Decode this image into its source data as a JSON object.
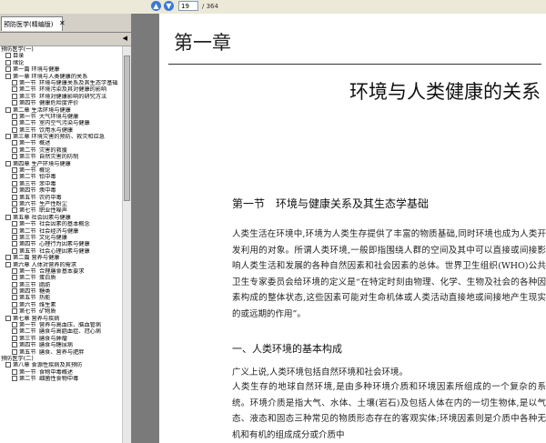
{
  "toolbar": {
    "page_current": "19",
    "page_total": "/ 364"
  },
  "sidebar": {
    "tab_label": "预防医学(精编版)",
    "tree": [
      {
        "level": 0,
        "label": "预防医学(一)"
      },
      {
        "level": 1,
        "label": "目录"
      },
      {
        "level": 1,
        "label": "绪论"
      },
      {
        "level": 1,
        "label": "第一篇 环境与健康"
      },
      {
        "level": 1,
        "label": "第一章 环境与人类健康的关系"
      },
      {
        "level": 2,
        "sec": "第一节",
        "label": "环境与健康关系及其生态学基础"
      },
      {
        "level": 2,
        "sec": "第二节",
        "label": "环境污染及其对健康的影响"
      },
      {
        "level": 2,
        "sec": "第三节",
        "label": "环境对健康影响的研究方法"
      },
      {
        "level": 2,
        "sec": "第四节",
        "label": "健康危险度评价"
      },
      {
        "level": 1,
        "label": "第二章 生活环境与健康"
      },
      {
        "level": 2,
        "sec": "第一节",
        "label": "大气环境与健康"
      },
      {
        "level": 2,
        "sec": "第二节",
        "label": "室内空气污染与健康"
      },
      {
        "level": 2,
        "sec": "第三节",
        "label": "饮用水与健康"
      },
      {
        "level": 1,
        "label": "第三章 环境灾害的预防、救灾和应急"
      },
      {
        "level": 2,
        "sec": "第一节",
        "label": "概述"
      },
      {
        "level": 2,
        "sec": "第二节",
        "label": "灾害的救援"
      },
      {
        "level": 2,
        "sec": "第三节",
        "label": "自然灾害的防制"
      },
      {
        "level": 1,
        "label": "第四章 生产环境与健康"
      },
      {
        "level": 2,
        "sec": "第一节",
        "label": "概论"
      },
      {
        "level": 2,
        "sec": "第二节",
        "label": "铅中毒"
      },
      {
        "level": 2,
        "sec": "第三节",
        "label": "苯中毒"
      },
      {
        "level": 2,
        "sec": "第四节",
        "label": "汞中毒"
      },
      {
        "level": 2,
        "sec": "第五节",
        "label": "农药中毒"
      },
      {
        "level": 2,
        "sec": "第六节",
        "label": "生产性粉尘"
      },
      {
        "level": 2,
        "sec": "第七节",
        "label": "职业性噪声"
      },
      {
        "level": 1,
        "label": "第五章 社会因素与健康"
      },
      {
        "level": 2,
        "sec": "第一节",
        "label": "社会因素的基本概念"
      },
      {
        "level": 2,
        "sec": "第二节",
        "label": "社会经济与健康"
      },
      {
        "level": 2,
        "sec": "第三节",
        "label": "文化与健康"
      },
      {
        "level": 2,
        "sec": "第四节",
        "label": "心理行为因素与健康"
      },
      {
        "level": 2,
        "sec": "第五节",
        "label": "社会心理因素与健康"
      },
      {
        "level": 1,
        "label": "第二篇 营养与健康"
      },
      {
        "level": 1,
        "label": "第六章 人体对营养的需求"
      },
      {
        "level": 2,
        "sec": "第一节",
        "label": "合理膳食基本要求"
      },
      {
        "level": 2,
        "sec": "第二节",
        "label": "蛋白质"
      },
      {
        "level": 2,
        "sec": "第三节",
        "label": "脂肪"
      },
      {
        "level": 2,
        "sec": "第四节",
        "label": "糖类"
      },
      {
        "level": 2,
        "sec": "第五节",
        "label": "热能"
      },
      {
        "level": 2,
        "sec": "第六节",
        "label": "维生素"
      },
      {
        "level": 2,
        "sec": "第七节",
        "label": "矿物质"
      },
      {
        "level": 1,
        "label": "第七章 营养与疾病"
      },
      {
        "level": 2,
        "sec": "第一节",
        "label": "营养与高血压、脑血管病"
      },
      {
        "level": 2,
        "sec": "第二节",
        "label": "膳食与高脂血症、冠心病"
      },
      {
        "level": 2,
        "sec": "第三节",
        "label": "膳食与肿瘤"
      },
      {
        "level": 2,
        "sec": "第四节",
        "label": "膳食与糖尿病"
      },
      {
        "level": 2,
        "sec": "第五节",
        "label": "膳食、营养与肥胖"
      },
      {
        "level": 0,
        "label": "预防医学(二)"
      },
      {
        "level": 1,
        "label": "第八章 食源性疾病及其预防"
      },
      {
        "level": 2,
        "sec": "第一节",
        "label": "食物中毒概述"
      },
      {
        "level": 2,
        "sec": "第二节",
        "label": "细菌性食物中毒"
      }
    ]
  },
  "page": {
    "chapter_num": "第一章",
    "chapter_title": "环境与人类健康的关系",
    "section_title": "第一节　环境与健康关系及其生态学基础",
    "para1": "人类生活在环境中,环境为人类生存提供了丰富的物质基础,同时环境也成为人类开发利用的对象。所谓人类环境,一般即指围绕人群的空间及其中可以直接或间接影响人类生活和发展的各种自然因素和社会因素的总体。世界卫生组织(WHO)公共卫生专家委员会给环境的定义是“在特定时刻由物理、化学、生物及社会的各种因素构成的整体状态,这些因素可能对生命机体或人类活动直接地或间接地产生现实的或远期的作用”。",
    "subhead": "一、人类环境的基本构成",
    "para2": "广义上说,人类环境包括自然环境和社会环境。",
    "para3": "人类生存的地球自然环境,是由多种环境介质和环境因素所组成的一个复杂的系统。环境介质是指大气、水体、土壤(岩石)及包括人体在内的一切生物体,是以气态、液态和固态三种常见的物质形态存在的客观实体;环境因素则是介质中各种无机和有机的组成成分或介质中"
  }
}
